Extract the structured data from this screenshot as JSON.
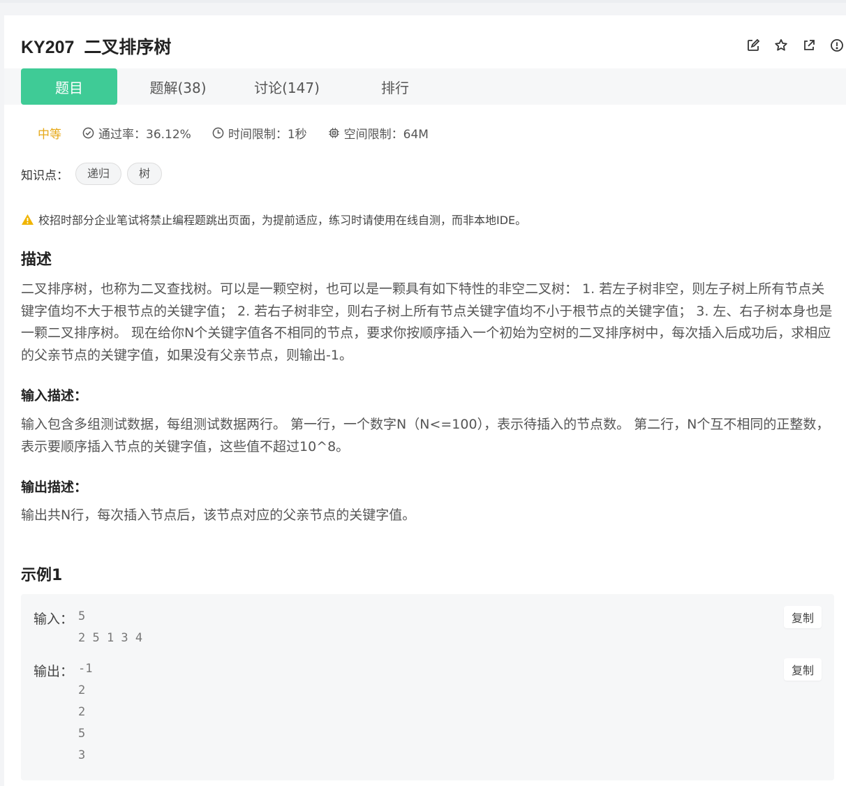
{
  "problem": {
    "id": "KY207",
    "title": "二叉排序树"
  },
  "tabs": [
    {
      "label": "题目",
      "active": true
    },
    {
      "label": "题解(38)"
    },
    {
      "label": "讨论(147)"
    },
    {
      "label": "排行"
    }
  ],
  "meta": {
    "difficulty": "中等",
    "pass_rate": "通过率：36.12%",
    "time_limit": "时间限制：1秒",
    "space_limit": "空间限制：64M"
  },
  "knowledge": {
    "label": "知识点：",
    "tags": [
      "递归",
      "树"
    ]
  },
  "warning": "校招时部分企业笔试将禁止编程题跳出页面，为提前适应，练习时请使用在线自测，而非本地IDE。",
  "description": {
    "heading": "描述",
    "text": "二叉排序树，也称为二叉查找树。可以是一颗空树，也可以是一颗具有如下特性的非空二叉树： 1. 若左子树非空，则左子树上所有节点关键字值均不大于根节点的关键字值； 2. 若右子树非空，则右子树上所有节点关键字值均不小于根节点的关键字值； 3. 左、右子树本身也是一颗二叉排序树。 现在给你N个关键字值各不相同的节点，要求你按顺序插入一个初始为空树的二叉排序树中，每次插入后成功后，求相应的父亲节点的关键字值，如果没有父亲节点，则输出-1。"
  },
  "input_desc": {
    "heading": "输入描述：",
    "text": "输入包含多组测试数据，每组测试数据两行。 第一行，一个数字N（N<=100），表示待插入的节点数。 第二行，N个互不相同的正整数，表示要顺序插入节点的关键字值，这些值不超过10^8。"
  },
  "output_desc": {
    "heading": "输出描述：",
    "text": "输出共N行，每次插入节点后，该节点对应的父亲节点的关键字值。"
  },
  "example": {
    "heading": "示例1",
    "input_label": "输入：",
    "input_lines": "5\n2 5 1 3 4",
    "output_label": "输出：",
    "output_lines": "-1\n2\n2\n5\n3",
    "copy_label": "复制"
  },
  "colors": {
    "accent": "#3fcb96",
    "difficulty": "#e6a817",
    "warning": "#f0b400"
  }
}
